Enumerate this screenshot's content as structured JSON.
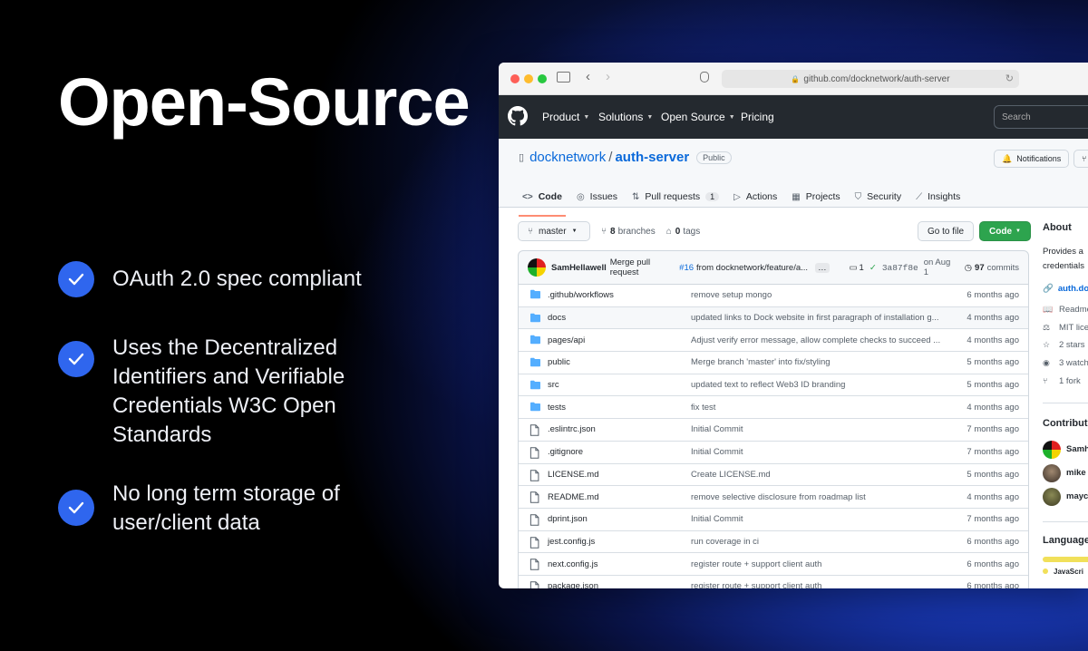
{
  "headline": "Open-Source",
  "features": [
    {
      "text": "OAuth 2.0 spec compliant"
    },
    {
      "text": "Uses the Decentralized Identifiers and Verifiable Credentials W3C Open Standards"
    },
    {
      "text": "No long term storage of user/client data"
    }
  ],
  "browser": {
    "url": "github.com/docknetwork/auth-server"
  },
  "github_nav": {
    "items": [
      "Product",
      "Solutions",
      "Open Source",
      "Pricing"
    ],
    "search_placeholder": "Search"
  },
  "repo": {
    "owner": "docknetwork",
    "sep": "/",
    "name": "auth-server",
    "visibility": "Public",
    "notifications_label": "Notifications"
  },
  "tabs": [
    {
      "icon": "<>",
      "label": "Code"
    },
    {
      "icon": "◎",
      "label": "Issues"
    },
    {
      "icon": "⇅",
      "label": "Pull requests",
      "count": "1"
    },
    {
      "icon": "▷",
      "label": "Actions"
    },
    {
      "icon": "▦",
      "label": "Projects"
    },
    {
      "icon": "⛉",
      "label": "Security"
    },
    {
      "icon": "⟋",
      "label": "Insights"
    }
  ],
  "toolbar": {
    "branch": "master",
    "branches_count": "8",
    "branches_label": "branches",
    "tags_count": "0",
    "tags_label": "tags",
    "go_to_file": "Go to file",
    "code_label": "Code"
  },
  "commit": {
    "author": "SamHellawell",
    "message_pre": "Merge pull request",
    "pr": "#16",
    "message_post": "from docknetwork/feature/a...",
    "ellipsis": "…",
    "checks": "1",
    "hash": "3a87f8e",
    "date": "on Aug 1",
    "count": "97",
    "count_label": "commits"
  },
  "files": [
    {
      "type": "dir",
      "name": ".github/workflows",
      "message": "remove setup mongo",
      "time": "6 months ago"
    },
    {
      "type": "dir",
      "name": "docs",
      "message": "updated links to Dock website in first paragraph of installation g...",
      "time": "4 months ago"
    },
    {
      "type": "dir",
      "name": "pages/api",
      "message": "Adjust verify error message, allow complete checks to succeed ...",
      "time": "4 months ago"
    },
    {
      "type": "dir",
      "name": "public",
      "message": "Merge branch 'master' into fix/styling",
      "time": "5 months ago"
    },
    {
      "type": "dir",
      "name": "src",
      "message": "updated text to reflect Web3 ID branding",
      "time": "5 months ago"
    },
    {
      "type": "dir",
      "name": "tests",
      "message": "fix test",
      "time": "4 months ago"
    },
    {
      "type": "file",
      "name": ".eslintrc.json",
      "message": "Initial Commit",
      "time": "7 months ago"
    },
    {
      "type": "file",
      "name": ".gitignore",
      "message": "Initial Commit",
      "time": "7 months ago"
    },
    {
      "type": "file",
      "name": "LICENSE.md",
      "message": "Create LICENSE.md",
      "time": "5 months ago"
    },
    {
      "type": "file",
      "name": "README.md",
      "message": "remove selective disclosure from roadmap list",
      "time": "4 months ago"
    },
    {
      "type": "file",
      "name": "dprint.json",
      "message": "Initial Commit",
      "time": "7 months ago"
    },
    {
      "type": "file",
      "name": "jest.config.js",
      "message": "run coverage in ci",
      "time": "6 months ago"
    },
    {
      "type": "file",
      "name": "next.config.js",
      "message": "register route + support client auth",
      "time": "6 months ago"
    },
    {
      "type": "file",
      "name": "package.json",
      "message": "register route + support client auth",
      "time": "6 months ago"
    }
  ],
  "about": {
    "heading": "About",
    "desc1": "Provides a",
    "desc2": "credentials",
    "link": "auth.do",
    "items": [
      {
        "icon": "📖",
        "text": "Readme"
      },
      {
        "icon": "⚖",
        "text": "MIT lice"
      },
      {
        "icon": "☆",
        "text": "2 stars"
      },
      {
        "icon": "◉",
        "text": "3 watch"
      },
      {
        "icon": "⑂",
        "text": "1 fork"
      }
    ]
  },
  "contributors": {
    "heading": "Contribute",
    "names": [
      "Samh",
      "mike",
      "mayc"
    ]
  },
  "languages": {
    "heading": "Language",
    "first": "JavaScri"
  },
  "colors": {
    "accent": "#2f66ee",
    "green": "#2da44e",
    "link": "#0969da"
  }
}
